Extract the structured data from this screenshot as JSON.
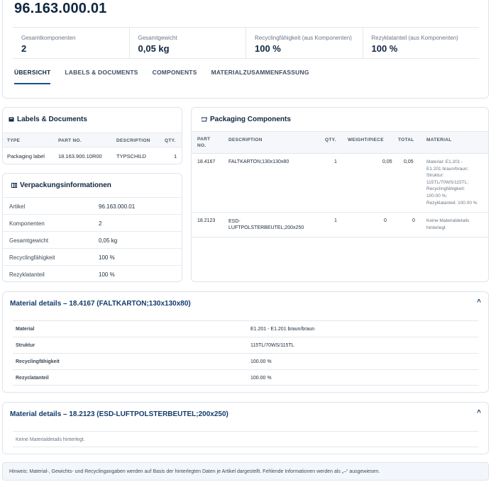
{
  "header": {
    "title": "96.163.000.01"
  },
  "stats": [
    {
      "label": "Gesamtkomponenten",
      "value": "2"
    },
    {
      "label": "Gesamtgewicht",
      "value": "0,05 kg"
    },
    {
      "label": "Recyclingfähigkeit (aus Komponenten)",
      "value": "100 %"
    },
    {
      "label": "Rezyklatanteil (aus Komponenten)",
      "value": "100 %"
    }
  ],
  "tabs": [
    {
      "label": "ÜBERSICHT",
      "active": true
    },
    {
      "label": "LABELS & DOCUMENTS"
    },
    {
      "label": "COMPONENTS"
    },
    {
      "label": "MATERIALZUSAMMENFASSUNG"
    }
  ],
  "labels_documents": {
    "title": "Labels & Documents",
    "columns": [
      "TYPE",
      "PART NO.",
      "DESCRIPTION",
      "QTY."
    ],
    "rows": [
      {
        "type": "Packaging label",
        "part_no": "18.163.900.10R00",
        "description": "TYPSCHILD",
        "qty": "1"
      }
    ]
  },
  "packaging_info": {
    "title": "Verpackungsinformationen",
    "rows": [
      {
        "key": "Artikel",
        "value": "96.163.000.01"
      },
      {
        "key": "Komponenten",
        "value": "2"
      },
      {
        "key": "Gesamtgewicht",
        "value": "0,05 kg"
      },
      {
        "key": "Recyclingfähigkeit",
        "value": "100 %"
      },
      {
        "key": "Rezyklatanteil",
        "value": "100 %"
      }
    ]
  },
  "packaging_components": {
    "title": "Packaging Components",
    "columns": {
      "part_no_1": "PART",
      "part_no_2": "NO.",
      "description": "DESCRIPTION",
      "qty": "QTY.",
      "weight": "WEIGHT/PIECE",
      "total": "TOTAL",
      "material": "MATERIAL"
    },
    "rows": [
      {
        "part_no": "18.4167",
        "description": "FALTKARTON;130x130x80",
        "qty": "1",
        "weight": "0,05",
        "total": "0,05",
        "material_lines": [
          "Material: E1.201 -",
          "E1.201 braun/braun;",
          "Struktur:",
          "115TL/70WS/115TL;",
          "Recyclingfähigkeit:",
          "100.00 %;",
          "Rezyklatanteil: 100.00 %"
        ]
      },
      {
        "part_no": "18.2123",
        "description_lines": [
          "ESD-",
          "LUFTPOLSTERBEUTEL;200x250"
        ],
        "qty": "1",
        "weight": "0",
        "total": "0",
        "material_lines": [
          "Keine Materialdetails",
          "hinterlegt"
        ]
      }
    ]
  },
  "material_details": [
    {
      "title": "Material details – 18.4167 (FALTKARTON;130x130x80)",
      "toggle": "^",
      "rows": [
        {
          "key": "Material",
          "value": "E1.201 - E1.201 braun/braun"
        },
        {
          "key": "Struktur",
          "value": "115TL/70WS/115TL"
        },
        {
          "key": "Recyclingfähigkeit",
          "value": "100.00 %"
        },
        {
          "key": "Rezyclatanteil",
          "value": "100.00 %"
        }
      ]
    },
    {
      "title": "Material details – 18.2123 (ESD-LUFTPOLSTERBEUTEL;200x250)",
      "toggle": "^",
      "empty_text": "Keine Materialdetails hinterlegt."
    }
  ],
  "note": "Hinweis: Material-, Gewichts- und Recyclingangaben werden auf Basis der hinterlegten Daten je Artikel dargestellt. Fehlende Informationen werden als „–“ ausgewiesen.",
  "colors": {
    "accent": "#1d4f8a",
    "title": "#0f2740",
    "muted": "#6b7785",
    "border": "#dfe4ea"
  }
}
